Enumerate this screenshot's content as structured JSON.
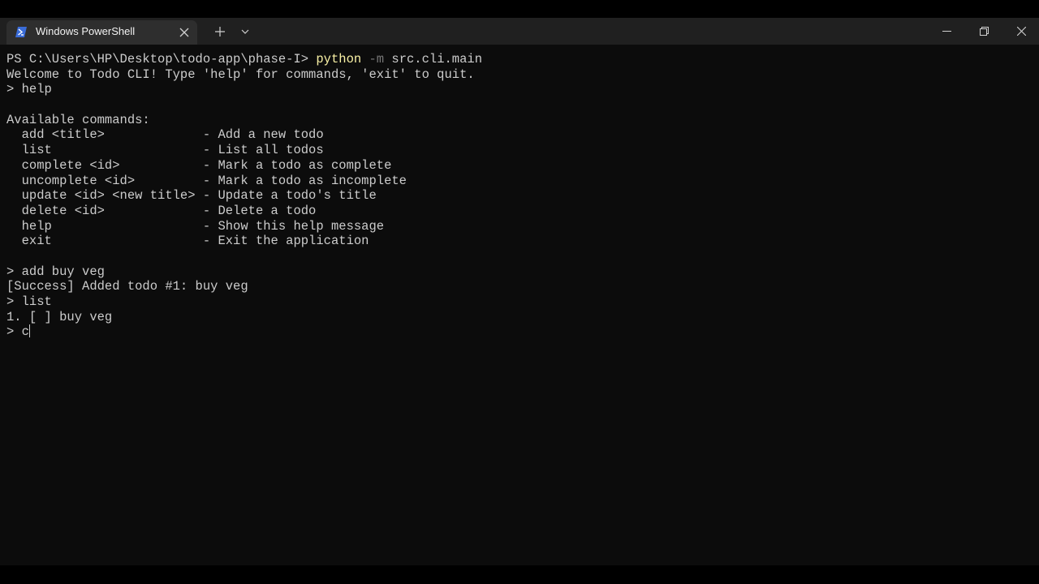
{
  "colors": {
    "terminal_bg": "#0c0c0c",
    "titlebar_bg": "#202020",
    "tab_bg": "#2e2e2e",
    "text": "#cccccc",
    "command_highlight": "#f9f1a5",
    "parameter": "#767676",
    "powershell_icon": "#3a6cd8"
  },
  "tab": {
    "title": "Windows PowerShell",
    "icon": "powershell-icon",
    "close_icon": "close-icon"
  },
  "toolbar": {
    "new_tab_icon": "plus-icon",
    "dropdown_icon": "chevron-down-icon"
  },
  "window_controls": {
    "minimize": "minimize-icon",
    "restore": "restore-icon",
    "close": "close-icon"
  },
  "terminal": {
    "prompt_path": "PS C:\\Users\\HP\\Desktop\\todo-app\\phase-I> ",
    "command": "python",
    "param": " -m",
    "args": " src.cli.main",
    "lines": [
      "Welcome to Todo CLI! Type 'help' for commands, 'exit' to quit.",
      "> help",
      "",
      "Available commands:",
      "  add <title>             - Add a new todo",
      "  list                    - List all todos",
      "  complete <id>           - Mark a todo as complete",
      "  uncomplete <id>         - Mark a todo as incomplete",
      "  update <id> <new title> - Update a todo's title",
      "  delete <id>             - Delete a todo",
      "  help                    - Show this help message",
      "  exit                    - Exit the application",
      "",
      "> add buy veg",
      "[Success] Added todo #1: buy veg",
      "> list",
      "1. [ ] buy veg"
    ],
    "current_input": "> c"
  }
}
